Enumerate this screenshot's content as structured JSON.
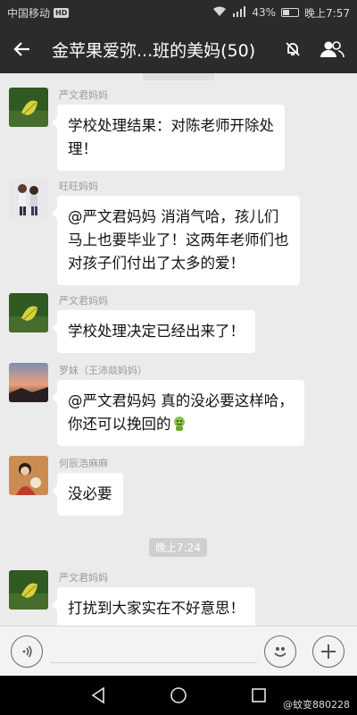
{
  "status_bar": {
    "carrier": "中国移动",
    "hd_badge": "HD",
    "battery": "43%",
    "battery_level": 0.43,
    "time": "晚上7:57"
  },
  "header": {
    "title": "金苹果爱弥...班的美妈(50)"
  },
  "messages": [
    {
      "sender": "严文君妈妈",
      "lines": [
        "学校处理结果：对陈老师开除处",
        "理！"
      ]
    },
    {
      "sender": "旺旺妈妈",
      "lines": [
        "@严文君妈妈  消消气哈，孩儿们",
        "马上也要毕业了！这两年老师们也",
        "对孩子们付出了太多的爱！"
      ]
    },
    {
      "sender": "严文君妈妈",
      "lines": [
        "学校处理决定已经出来了！"
      ]
    },
    {
      "sender": "罗妹（王沛燚妈妈）",
      "lines": [
        "@严文君妈妈  真的没必要这样哈，",
        "你还可以挽回的"
      ]
    },
    {
      "sender": "何辰浩麻麻",
      "lines": [
        "没必要"
      ]
    },
    {
      "sender": "严文君妈妈",
      "lines": [
        "打扰到大家实在不好意思！"
      ]
    }
  ],
  "time_divider": "晚上7:24",
  "watermark": "@蚊变880228"
}
